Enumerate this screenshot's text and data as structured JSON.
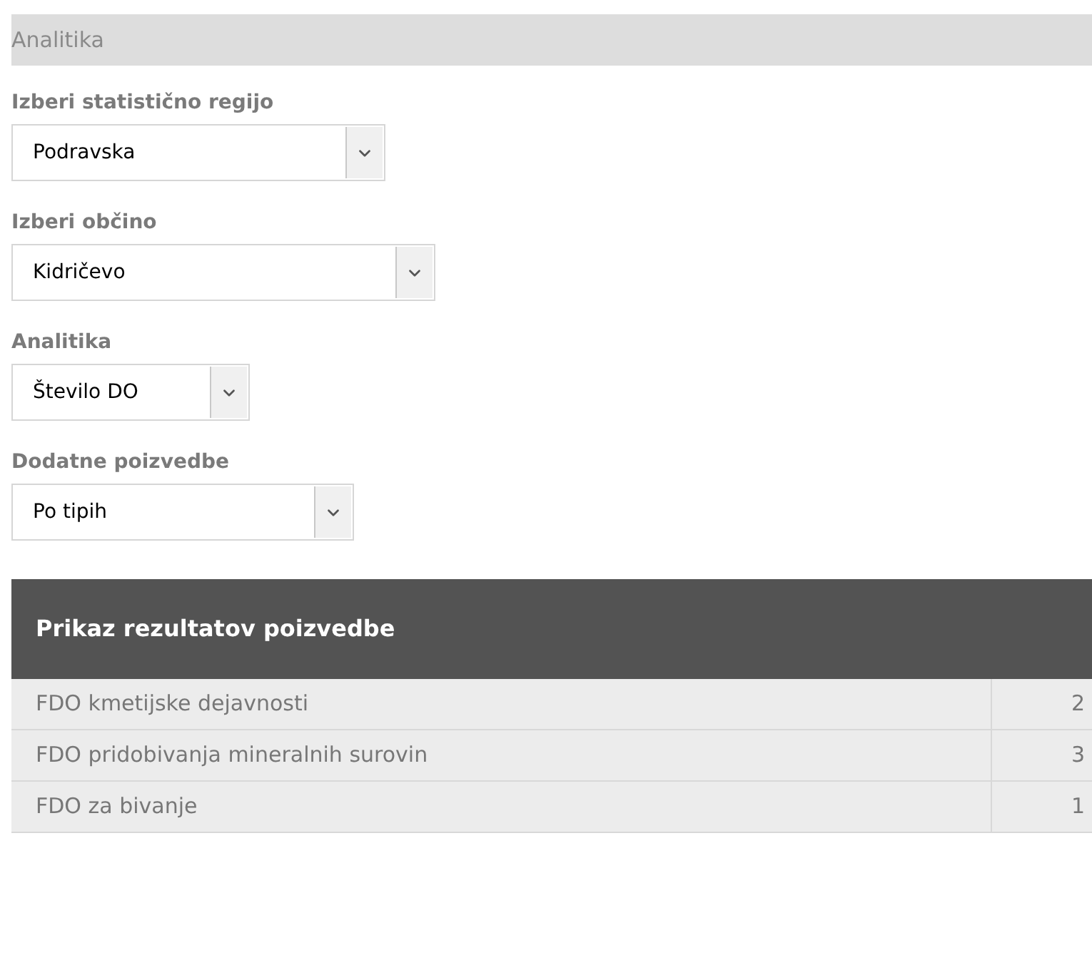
{
  "section_title": "Analitika",
  "fields": [
    {
      "label": "Izberi statistično regijo",
      "value": "Podravska"
    },
    {
      "label": "Izberi občino",
      "value": "Kidričevo"
    },
    {
      "label": "Analitika",
      "value": "Število DO"
    },
    {
      "label": "Dodatne poizvedbe",
      "value": "Po tipih"
    }
  ],
  "results": {
    "title": "Prikaz rezultatov poizvedbe",
    "rows": [
      {
        "name": "FDO kmetijske dejavnosti",
        "count": "2"
      },
      {
        "name": "FDO pridobivanja mineralnih surovin",
        "count": "3"
      },
      {
        "name": "FDO za bivanje",
        "count": "1"
      }
    ]
  }
}
